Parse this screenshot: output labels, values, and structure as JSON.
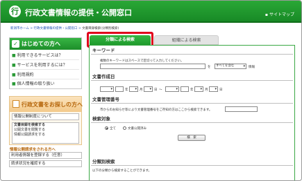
{
  "header": {
    "title": "行政文書情報の提供・公開窓口",
    "logo_char": "行",
    "sitemap": "サイトマップ"
  },
  "breadcrumb": {
    "items": [
      "新潟市ホーム",
      ">",
      "行政文書情報の提供・公開窓口",
      ">"
    ],
    "current": "文書目録検索(分類別検索)"
  },
  "sidebar": {
    "box1": {
      "title": "はじめての方へ",
      "items": [
        "利用できるサービスは？",
        "サービスを利用するには？",
        "利用規約",
        "個人情報の取り扱い"
      ]
    },
    "box2": {
      "title": "行政文書をお探しの方へ",
      "items": [
        "情報公開制度について",
        "文書目録を検索する",
        "公開文書を閲覧する",
        "情報公開請求をする"
      ]
    },
    "section_title": "情報公開請求をされる方へ",
    "box3": {
      "items": [
        "利用者情報を登録する（任意）",
        "請求状況を確認する"
      ]
    }
  },
  "tabs": [
    {
      "label": "分類による検索",
      "active": true
    },
    {
      "label": "組織による検索",
      "active": false
    }
  ],
  "form": {
    "keyword": {
      "title": "キーワード",
      "hint": "複数のキーワードはスペースで区切って入力してください。",
      "match_prefix": "を",
      "match_value": "すべてを含む",
      "match_suffix": "情報"
    },
    "created": {
      "title": "文書作成日",
      "era1": "",
      "era2": "",
      "y": "年",
      "m": "月",
      "d": "日",
      "sep": "〜"
    },
    "docno": {
      "title": "文書管理番号",
      "hint": "市からのお知らせ等により文書管理番号をご存知の方はここから検索できます。"
    },
    "target": {
      "title": "検索対象",
      "opt_all": "全て",
      "opt_public": "文書公開済み"
    },
    "search_button": "検　索",
    "category": {
      "title": "分類別検索",
      "hint": "以下の分類から検索することができます。"
    }
  },
  "colors": {
    "brand": "#1d8e2a",
    "accent_red": "#e0001b",
    "link": "#1a4fb5"
  }
}
